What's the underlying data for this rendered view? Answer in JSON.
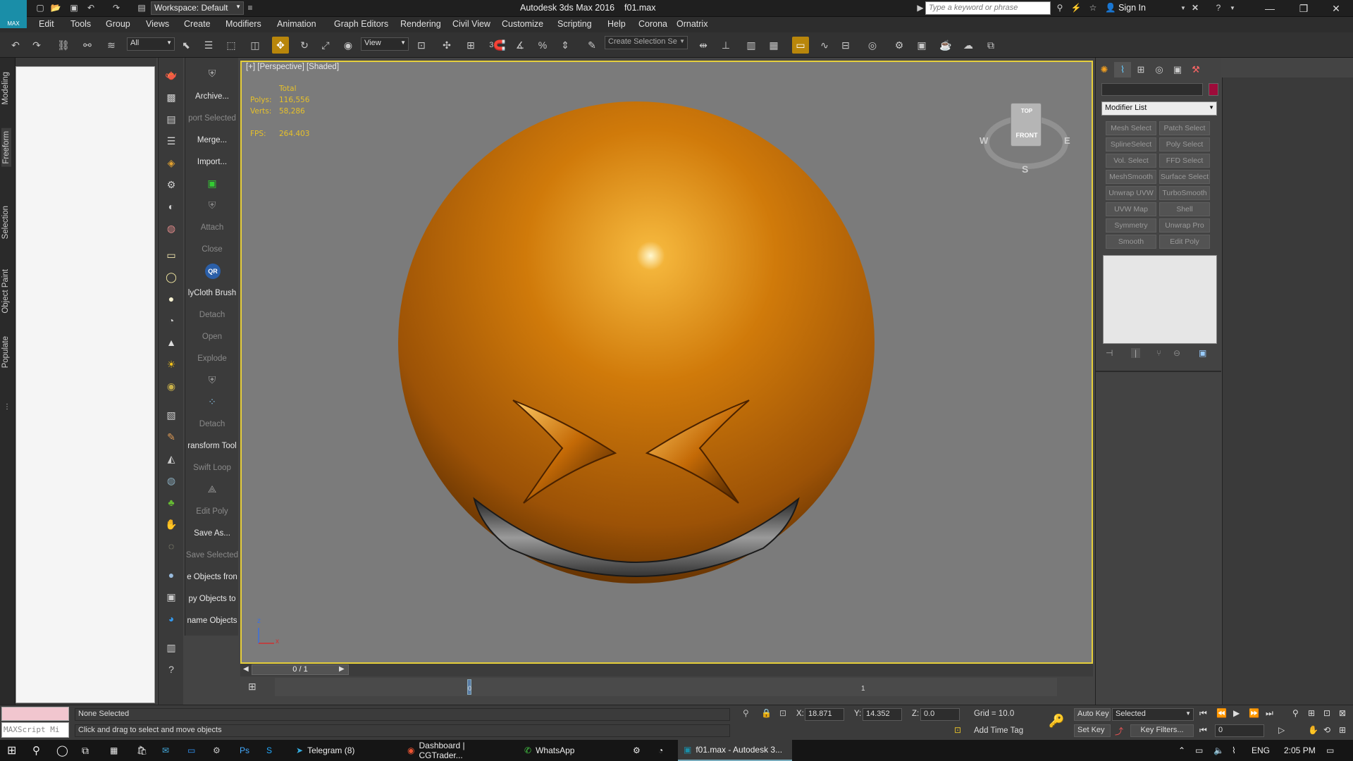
{
  "app": {
    "title": "Autodesk 3ds Max 2016",
    "file": "f01.max",
    "logo_label": "MAX",
    "workspace": "Workspace: Default",
    "search_placeholder": "Type a keyword or phrase",
    "sign_in": "Sign In"
  },
  "menu": [
    "Edit",
    "Tools",
    "Group",
    "Views",
    "Create",
    "Modifiers",
    "Animation",
    "Graph Editors",
    "Rendering",
    "Civil View",
    "Customize",
    "Scripting",
    "Help",
    "Corona",
    "Ornatrix"
  ],
  "toolbar": {
    "filter": "All",
    "ref_coord": "View",
    "selection_set": "Create Selection Se",
    "snap_3": "3",
    "snap_pct": "%"
  },
  "ribbon_tabs": [
    "Modeling",
    "Freeform",
    "Selection",
    "Object Paint",
    "Populate"
  ],
  "quick_panel": [
    {
      "label": "Archive...",
      "dim": false
    },
    {
      "label": "port Selected",
      "dim": true
    },
    {
      "label": "Merge...",
      "dim": false
    },
    {
      "label": "Import...",
      "dim": false
    },
    {
      "label": "",
      "dim": false
    },
    {
      "label": "",
      "dim": false
    },
    {
      "label": "Attach",
      "dim": true
    },
    {
      "label": "Close",
      "dim": true
    },
    {
      "label": "",
      "dim": false
    },
    {
      "label": "lyCloth Brush",
      "dim": false
    },
    {
      "label": "Detach",
      "dim": true
    },
    {
      "label": "Open",
      "dim": true
    },
    {
      "label": "Explode",
      "dim": true
    },
    {
      "label": "",
      "dim": false
    },
    {
      "label": "",
      "dim": false
    },
    {
      "label": "Detach",
      "dim": true
    },
    {
      "label": "ransform Tool",
      "dim": false
    },
    {
      "label": "Swift Loop",
      "dim": true
    },
    {
      "label": "",
      "dim": false
    },
    {
      "label": "Edit Poly",
      "dim": true
    },
    {
      "label": "Save As...",
      "dim": false
    },
    {
      "label": "Save Selected",
      "dim": true
    },
    {
      "label": "e Objects fron",
      "dim": false
    },
    {
      "label": "py Objects to",
      "dim": false
    },
    {
      "label": "name Objects",
      "dim": false
    }
  ],
  "viewport": {
    "label": "[+] [Perspective] [Shaded]",
    "stats_header": "Total",
    "polys_label": "Polys:",
    "polys_value": "116,556",
    "verts_label": "Verts:",
    "verts_value": "58,286",
    "fps_label": "FPS:",
    "fps_value": "264.403",
    "cube_top": "TOP",
    "cube_front": "FRONT",
    "compass_w": "W",
    "compass_e": "E",
    "compass_s": "S",
    "axis_z": "z",
    "axis_x": "x",
    "sphere_color": "#d07a0a"
  },
  "timeline": {
    "frame_display": "0 / 1",
    "marker_start": "0",
    "marker_end": "1"
  },
  "command_panel": {
    "modifier_list": "Modifier List",
    "name_color": "#9e0b3a",
    "modifiers": [
      "Mesh Select",
      "Patch Select",
      "SplineSelect",
      "Poly Select",
      "Vol. Select",
      "FFD Select",
      "MeshSmooth",
      "Surface Select",
      "Unwrap UVW",
      "TurboSmooth",
      "UVW Map",
      "Shell",
      "Symmetry",
      "Unwrap Pro",
      "Smooth",
      "Edit Poly"
    ]
  },
  "status": {
    "maxscript_placeholder": "MAXScript Mi",
    "selection": "None Selected",
    "prompt": "Click and drag to select and move objects",
    "x_label": "X:",
    "x": "18.871",
    "y_label": "Y:",
    "y": "14.352",
    "z_label": "Z:",
    "z": "0.0",
    "grid": "Grid = 10.0",
    "add_time_tag": "Add Time Tag",
    "auto_key": "Auto Key",
    "set_key": "Set Key",
    "key_mode": "Selected",
    "key_filters": "Key Filters...",
    "frame": "0"
  },
  "taskbar": {
    "items": [
      "Telegram (8)",
      "Dashboard | CGTrader...",
      "WhatsApp",
      "f01.max - Autodesk 3..."
    ],
    "lang": "ENG",
    "time": "2:05 PM"
  }
}
